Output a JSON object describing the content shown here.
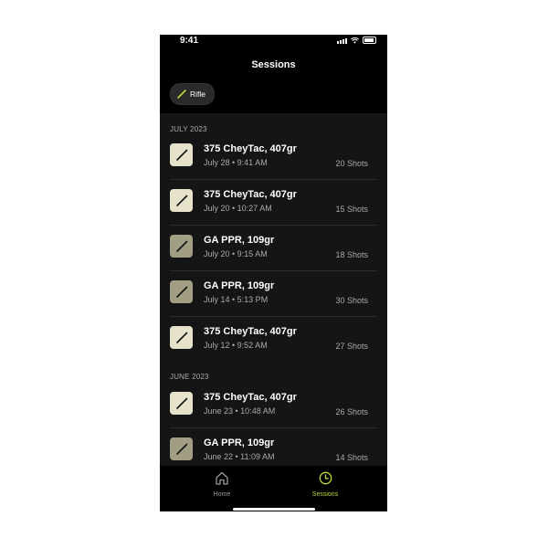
{
  "status": {
    "time": "9:41"
  },
  "header": {
    "title": "Sessions"
  },
  "filter": {
    "chip_label": "Rifle"
  },
  "sections": [
    {
      "label": "JULY 2023"
    },
    {
      "label": "JUNE 2023"
    }
  ],
  "sessions": [
    {
      "name": "375 CheyTac, 407gr",
      "date": "July 28 • 9:41 AM",
      "shots": "20 Shots",
      "icon_color": "#e6e2cc"
    },
    {
      "name": "375 CheyTac, 407gr",
      "date": "July 20 • 10:27 AM",
      "shots": "15 Shots",
      "icon_color": "#e6e2cc"
    },
    {
      "name": "GA PPR, 109gr",
      "date": "July 20 • 9:15 AM",
      "shots": "18 Shots",
      "icon_color": "#a19e83"
    },
    {
      "name": "GA PPR, 109gr",
      "date": "July 14 • 5:13 PM",
      "shots": "30 Shots",
      "icon_color": "#a19e83"
    },
    {
      "name": "375 CheyTac, 407gr",
      "date": "July 12 • 9:52 AM",
      "shots": "27 Shots",
      "icon_color": "#e6e2cc"
    },
    {
      "name": "375 CheyTac, 407gr",
      "date": "June 23 • 10:48 AM",
      "shots": "26 Shots",
      "icon_color": "#e6e2cc"
    },
    {
      "name": "GA PPR, 109gr",
      "date": "June 22 • 11:09 AM",
      "shots": "14 Shots",
      "icon_color": "#a19e83"
    }
  ],
  "tabbar": {
    "home_label": "Home",
    "sessions_label": "Sessions",
    "active_color": "#c5d43a",
    "inactive_color": "#9a9a9a"
  }
}
